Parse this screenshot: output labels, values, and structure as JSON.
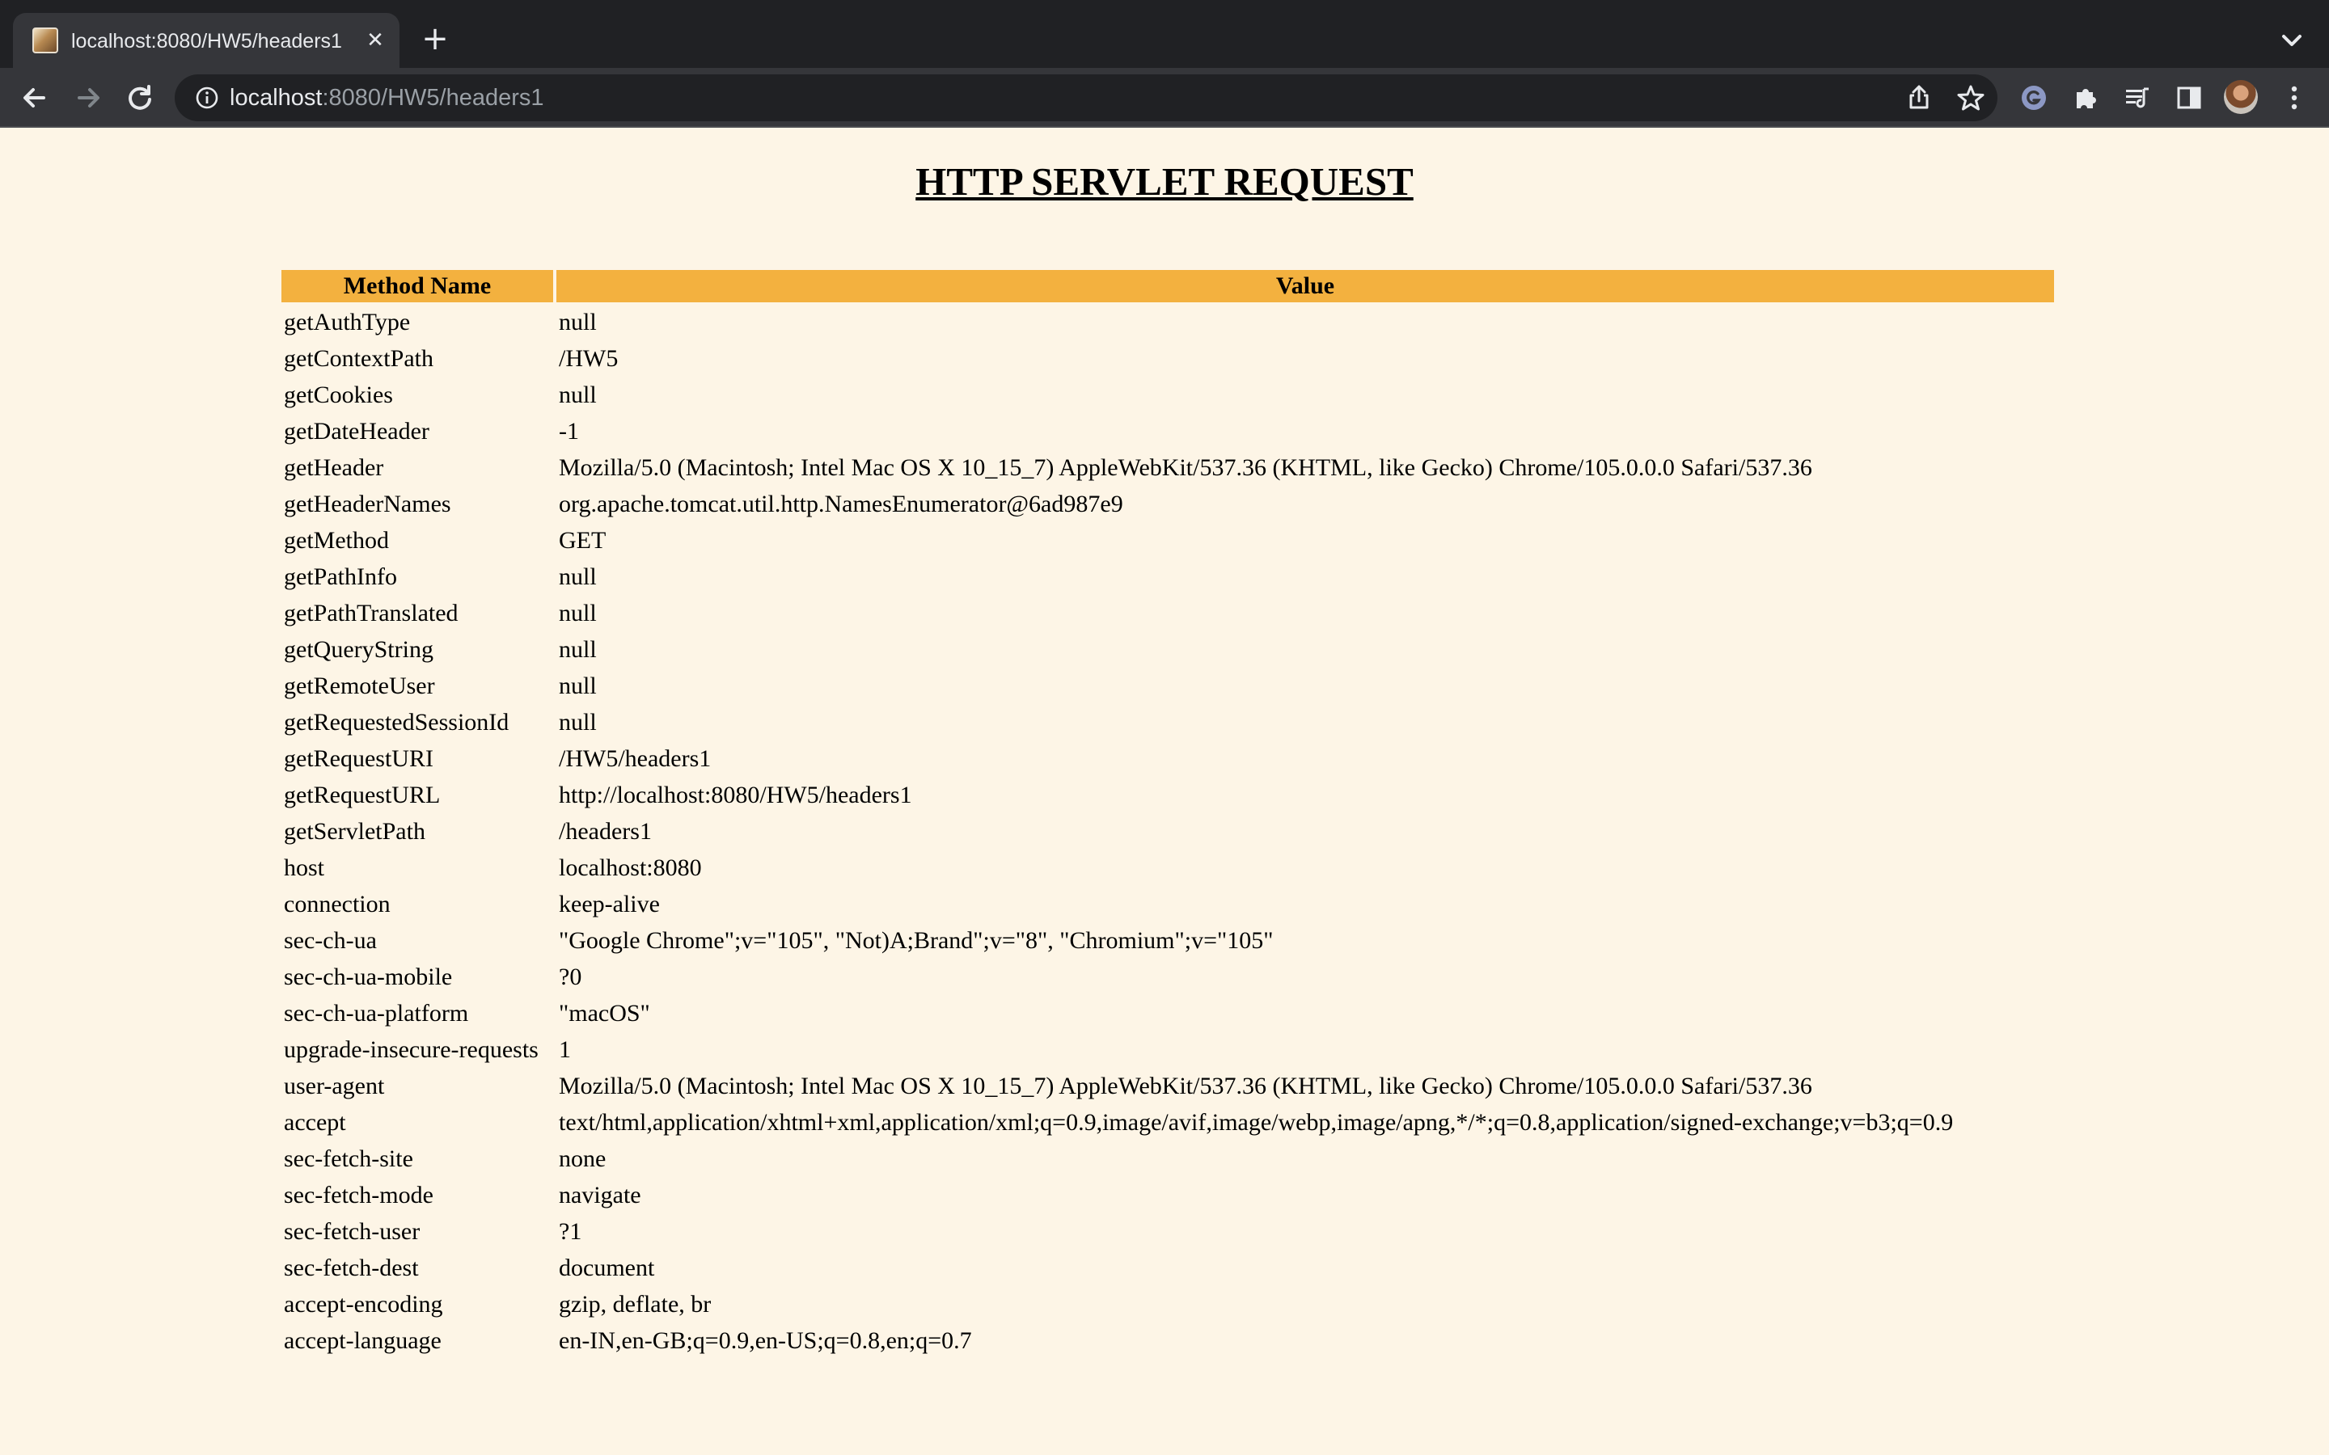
{
  "browser": {
    "tab": {
      "title": "localhost:8080/HW5/headers1",
      "favicon": "tomcat-favicon"
    },
    "url": {
      "host": "localhost",
      "rest": ":8080/HW5/headers1"
    },
    "icons": {
      "back": "arrow-left",
      "forward": "arrow-right",
      "reload": "reload",
      "info": "info-circle",
      "share": "share",
      "bookmark": "star",
      "grammarly": "grammarly",
      "extensions": "puzzle-piece",
      "media": "media-playlist",
      "side_panel": "side-panel",
      "menu": "three-dots-vertical",
      "tab_search": "chevron-down",
      "new_tab": "plus",
      "close_tab": "close"
    },
    "colors": {
      "tabstrip": "#202124",
      "toolbar": "#35363a",
      "page_bg": "#fdf5e6",
      "table_header": "#f3b13f"
    }
  },
  "page": {
    "title": "HTTP SERVLET REQUEST",
    "table": {
      "headers": [
        "Method Name",
        "Value"
      ],
      "rows": [
        [
          "getAuthType",
          "null"
        ],
        [
          "getContextPath",
          "/HW5"
        ],
        [
          "getCookies",
          "null"
        ],
        [
          "getDateHeader",
          "-1"
        ],
        [
          "getHeader",
          "Mozilla/5.0 (Macintosh; Intel Mac OS X 10_15_7) AppleWebKit/537.36 (KHTML, like Gecko) Chrome/105.0.0.0 Safari/537.36"
        ],
        [
          "getHeaderNames",
          "org.apache.tomcat.util.http.NamesEnumerator@6ad987e9"
        ],
        [
          "getMethod",
          "GET"
        ],
        [
          "getPathInfo",
          "null"
        ],
        [
          "getPathTranslated",
          "null"
        ],
        [
          "getQueryString",
          "null"
        ],
        [
          "getRemoteUser",
          "null"
        ],
        [
          "getRequestedSessionId",
          "null"
        ],
        [
          "getRequestURI",
          "/HW5/headers1"
        ],
        [
          "getRequestURL",
          "http://localhost:8080/HW5/headers1"
        ],
        [
          "getServletPath",
          "/headers1"
        ],
        [
          "host",
          "localhost:8080"
        ],
        [
          "connection",
          "keep-alive"
        ],
        [
          "sec-ch-ua",
          "\"Google Chrome\";v=\"105\", \"Not)A;Brand\";v=\"8\", \"Chromium\";v=\"105\""
        ],
        [
          "sec-ch-ua-mobile",
          "?0"
        ],
        [
          "sec-ch-ua-platform",
          "\"macOS\""
        ],
        [
          "upgrade-insecure-requests",
          "1"
        ],
        [
          "user-agent",
          "Mozilla/5.0 (Macintosh; Intel Mac OS X 10_15_7) AppleWebKit/537.36 (KHTML, like Gecko) Chrome/105.0.0.0 Safari/537.36"
        ],
        [
          "accept",
          "text/html,application/xhtml+xml,application/xml;q=0.9,image/avif,image/webp,image/apng,*/*;q=0.8,application/signed-exchange;v=b3;q=0.9"
        ],
        [
          "sec-fetch-site",
          "none"
        ],
        [
          "sec-fetch-mode",
          "navigate"
        ],
        [
          "sec-fetch-user",
          "?1"
        ],
        [
          "sec-fetch-dest",
          "document"
        ],
        [
          "accept-encoding",
          "gzip, deflate, br"
        ],
        [
          "accept-language",
          "en-IN,en-GB;q=0.9,en-US;q=0.8,en;q=0.7"
        ]
      ]
    }
  }
}
